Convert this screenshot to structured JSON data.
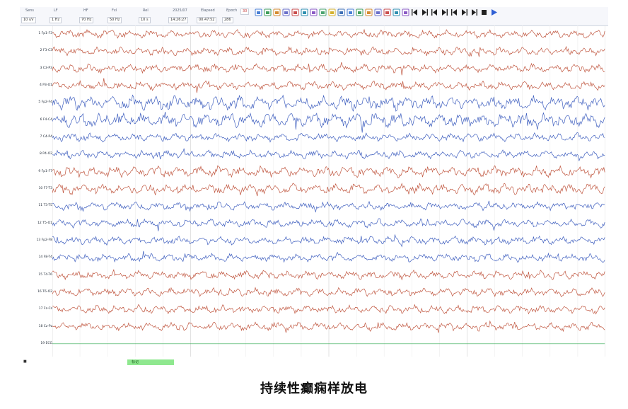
{
  "toolbar": {
    "fields": [
      {
        "label": "Sens",
        "value": "10 uV"
      },
      {
        "label": "LF",
        "value": "1 Hz"
      },
      {
        "label": "HF",
        "value": "70 Hz"
      },
      {
        "label": "Fxl",
        "value": "50 Hz"
      },
      {
        "label": "Rel",
        "value": "10 s"
      },
      {
        "label": "2025/07",
        "value": "14:26:27"
      },
      {
        "label": "Elapsed",
        "value": "00:47:52"
      },
      {
        "label": "Epoch",
        "value": "286"
      }
    ],
    "speed_label": "30",
    "icons": [
      "open-file-icon",
      "edit-icon",
      "document-icon",
      "save-icon",
      "print-icon",
      "chart-icon",
      "report-icon",
      "montage-icon",
      "filter-icon",
      "export-icon",
      "copy-icon",
      "note-icon",
      "map-icon",
      "video-icon",
      "topomap-icon",
      "spectrum-icon",
      "cut-icon",
      "fast-backward-icon",
      "fast-forward-icon",
      "step-back-icon",
      "step-forward-icon",
      "frame-prev-icon",
      "frame-next-icon",
      "skip-icon",
      "stop-icon",
      "play-icon"
    ]
  },
  "channels": [
    {
      "label": "1 Fp1-F3",
      "color": "#c0563f"
    },
    {
      "label": "2 F3-C3",
      "color": "#c0563f"
    },
    {
      "label": "3 C3-P3",
      "color": "#c0563f"
    },
    {
      "label": "4 P3-O1",
      "color": "#c0563f"
    },
    {
      "label": "5 Fp2-F4",
      "color": "#3f5fbf"
    },
    {
      "label": "6 F4-C4",
      "color": "#3f5fbf"
    },
    {
      "label": "7 C4-P4",
      "color": "#3f5fbf"
    },
    {
      "label": "8 P4-O2",
      "color": "#3f5fbf"
    },
    {
      "label": "9 Fp1-F7",
      "color": "#c0563f"
    },
    {
      "label": "10 F7-T3",
      "color": "#c0563f"
    },
    {
      "label": "11 T3-T5",
      "color": "#3f5fbf"
    },
    {
      "label": "12 T5-O1",
      "color": "#3f5fbf"
    },
    {
      "label": "13 Fp2-F8",
      "color": "#3f5fbf"
    },
    {
      "label": "14 F8-T4",
      "color": "#3f5fbf"
    },
    {
      "label": "15 T4-T6",
      "color": "#c0563f"
    },
    {
      "label": "16 T6-O2",
      "color": "#c0563f"
    },
    {
      "label": "17 Fz-Cz",
      "color": "#c0563f"
    },
    {
      "label": "18 Cz-Pz",
      "color": "#c0563f"
    },
    {
      "label": "19 ECG",
      "color": "#2fa84f"
    }
  ],
  "event_marker": "标记",
  "corner_mark": "■",
  "caption": "持续性癫痫样放电"
}
